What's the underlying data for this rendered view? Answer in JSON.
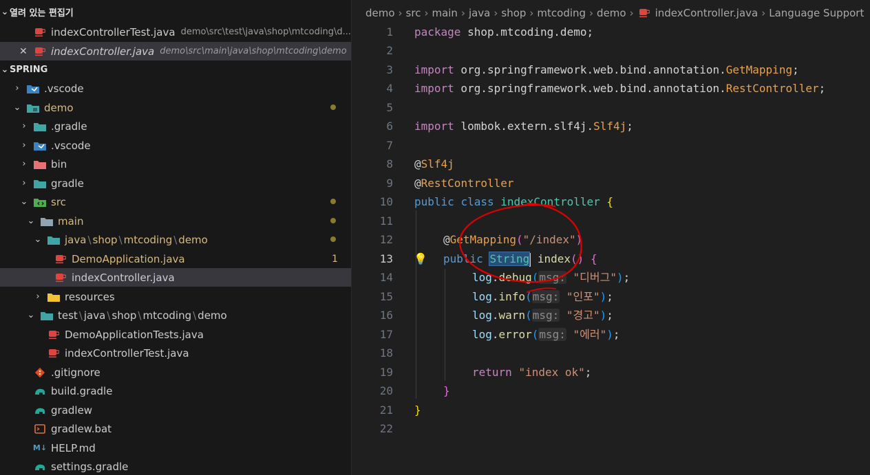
{
  "sidebar": {
    "open_editors_title": "열려 있는 편집기",
    "open_editors": [
      {
        "name": "indexControllerTest.java",
        "path": "demo\\src\\test\\java\\shop\\mtcoding\\d..."
      },
      {
        "name": "indexController.java",
        "path": "demo\\src\\main\\java\\shop\\mtcoding\\demo"
      }
    ],
    "workspace_title": "SPRING",
    "tree": {
      "vscode_root": ".vscode",
      "demo": "demo",
      "gradle_dot": ".gradle",
      "vscode": ".vscode",
      "bin": "bin",
      "gradle": "gradle",
      "src": "src",
      "main": "main",
      "pkg_main": [
        "java",
        "shop",
        "mtcoding",
        "demo"
      ],
      "demo_app": "DemoApplication.java",
      "demo_app_badge": "1",
      "index_controller": "indexController.java",
      "resources": "resources",
      "pkg_test": [
        "test",
        "java",
        "shop",
        "mtcoding",
        "demo"
      ],
      "demo_app_tests": "DemoApplicationTests.java",
      "index_controller_test": "indexControllerTest.java",
      "gitignore": ".gitignore",
      "build_gradle": "build.gradle",
      "gradlew": "gradlew",
      "gradlew_bat": "gradlew.bat",
      "help_md": "HELP.md",
      "settings_gradle": "settings.gradle"
    }
  },
  "breadcrumb": {
    "parts": [
      "demo",
      "src",
      "main",
      "java",
      "shop",
      "mtcoding",
      "demo"
    ],
    "file": "indexController.java",
    "last": "Language Support"
  },
  "editor": {
    "active_line": 13,
    "line_numbers": [
      "1",
      "2",
      "3",
      "4",
      "5",
      "6",
      "7",
      "8",
      "9",
      "10",
      "11",
      "12",
      "13",
      "14",
      "15",
      "16",
      "17",
      "18",
      "19",
      "20",
      "21",
      "22"
    ],
    "code": {
      "l1_kw": "package",
      "l1_rest": " shop.mtcoding.demo;",
      "l3_kw": "import",
      "l3_pkg": " org.springframework.web.bind.annotation.",
      "l3_cls": "GetMapping",
      "l3_end": ";",
      "l4_kw": "import",
      "l4_pkg": " org.springframework.web.bind.annotation.",
      "l4_cls": "RestController",
      "l4_end": ";",
      "l6_kw": "import",
      "l6_pkg": " lombok.extern.slf4j.",
      "l6_cls": "Slf4j",
      "l6_end": ";",
      "l8_at": "@",
      "l8_ann": "Slf4j",
      "l9_at": "@",
      "l9_ann": "RestController",
      "l10_kw": "public",
      "l10_kw2": "class",
      "l10_name": "indexController",
      "l10_brace": "{",
      "l12_at": "@",
      "l12_ann": "GetMapping",
      "l12_open": "(",
      "l12_str": "\"/index\"",
      "l12_close": ")",
      "l13_kw": "public",
      "l13_type": "String",
      "l13_name": "index",
      "l13_paren": "()",
      "l13_brace": "{",
      "log": "log",
      "debug": "debug",
      "info": "info",
      "warn": "warn",
      "error": "error",
      "hint": "msg:",
      "s_debug": "\"디버그\"",
      "s_info": "\"인포\"",
      "s_warn": "\"경고\"",
      "s_error": "\"에러\"",
      "l19_kw": "return",
      "l19_str": "\"index ok\"",
      "l19_end": ";",
      "l20": "}",
      "l21": "}"
    }
  },
  "colors": {
    "annotation_circle": "#e00000",
    "java_icon": "#e0443e",
    "folder_teal": "#42a5a5"
  }
}
